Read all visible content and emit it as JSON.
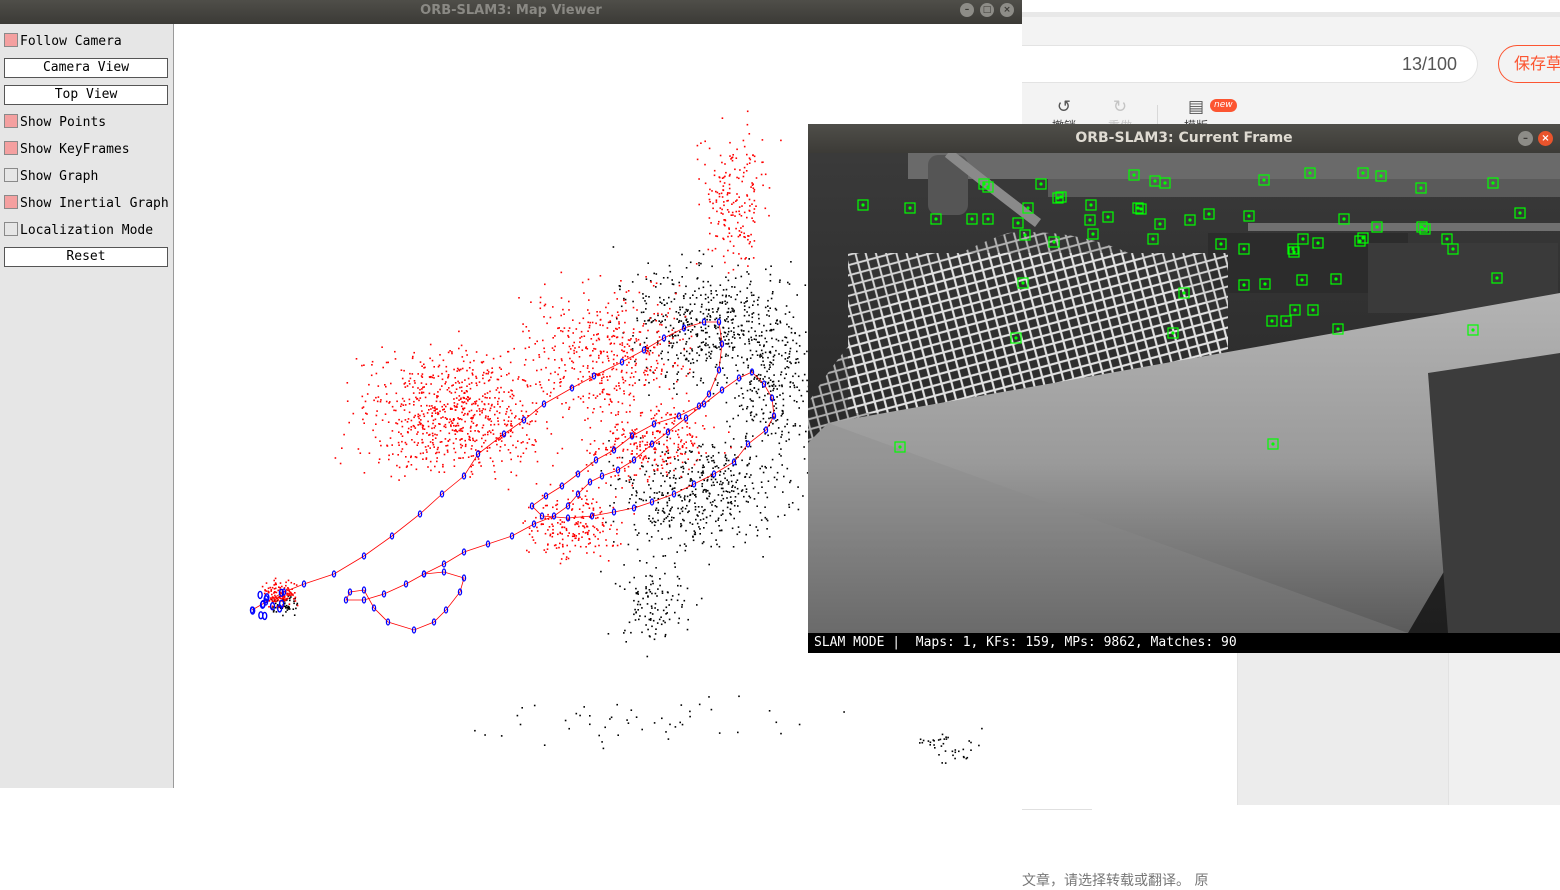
{
  "background_page": {
    "title_count": "13/100",
    "save_button": "保存草",
    "toolbar": {
      "undo_label": "撤销",
      "redo_label": "重做",
      "template_label": "模版",
      "new_badge": "new"
    },
    "hint_text": "文章，请选择转载或翻译。 原"
  },
  "map_viewer": {
    "title": "ORB-SLAM3: Map Viewer",
    "controls": {
      "follow_camera": {
        "label": "Follow Camera",
        "checked": true
      },
      "camera_view": "Camera View",
      "top_view": "Top View",
      "show_points": {
        "label": "Show Points",
        "checked": true
      },
      "show_keyframes": {
        "label": "Show KeyFrames",
        "checked": true
      },
      "show_graph": {
        "label": "Show Graph",
        "checked": false
      },
      "show_inertial_graph": {
        "label": "Show Inertial Graph",
        "checked": true
      },
      "localization_mode": {
        "label": "Localization Mode",
        "checked": false
      },
      "reset": "Reset"
    },
    "colors": {
      "reference_points": "#ff0000",
      "map_points": "#000000",
      "keyframes": "#0000ff",
      "graph_edges": "#ff0000"
    }
  },
  "current_frame": {
    "title": "ORB-SLAM3: Current Frame",
    "status": "SLAM MODE |  Maps: 1, KFs: 159, MPs: 9862, Matches: 90",
    "feature_color": "#00ff00"
  }
}
